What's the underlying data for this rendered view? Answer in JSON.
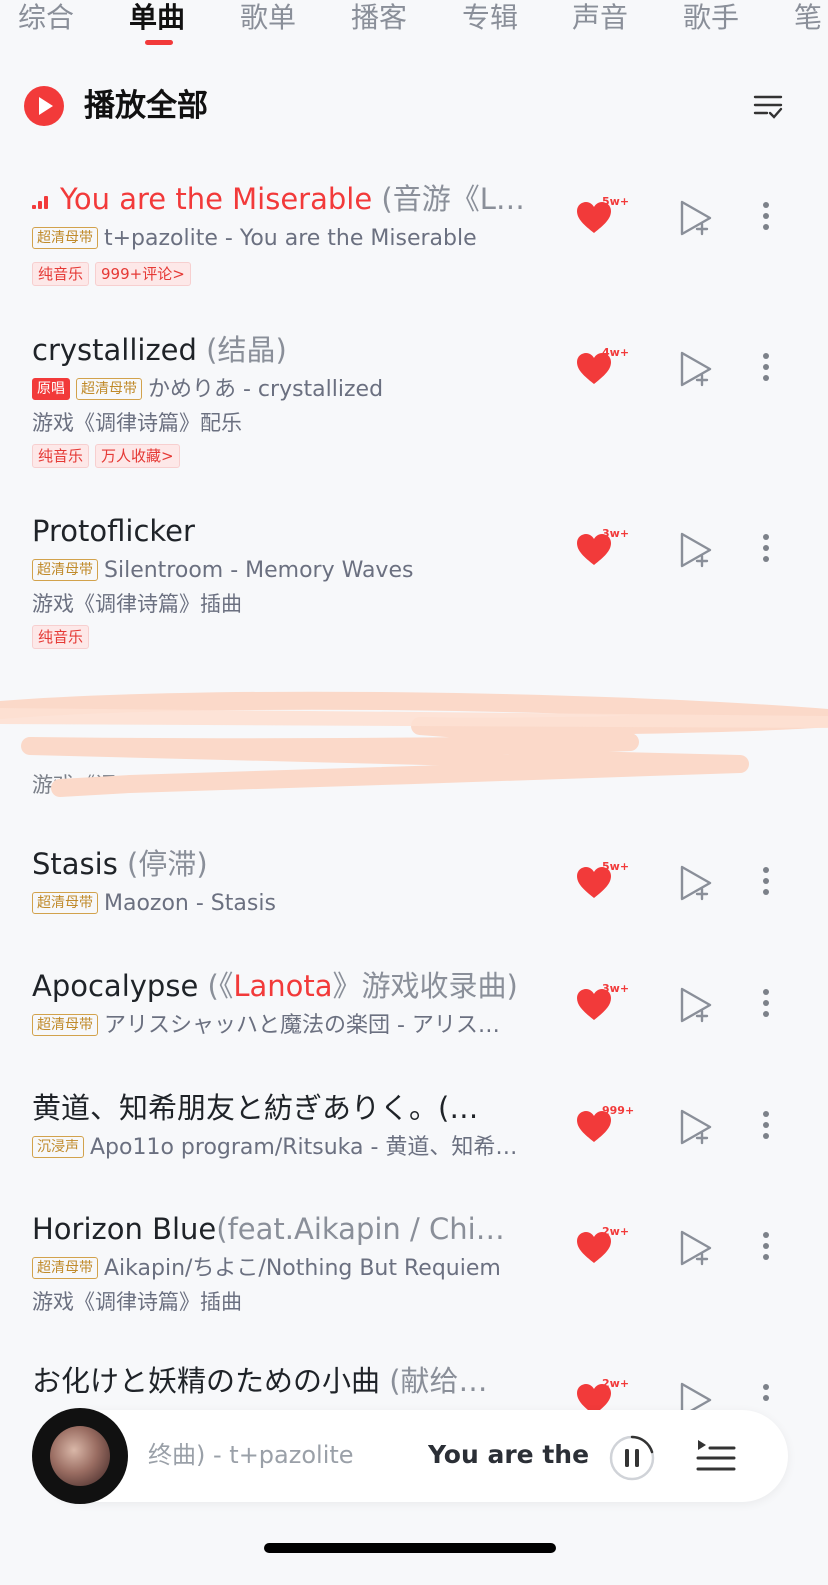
{
  "tabs": [
    "综合",
    "单曲",
    "歌单",
    "播客",
    "专辑",
    "声音",
    "歌手",
    "笔"
  ],
  "active_tab": "单曲",
  "play_all": {
    "label": "播放全部"
  },
  "songs": [
    {
      "title": "You are the Miserable",
      "sub": " (音游《L…",
      "meta_badges": [
        "超清母带"
      ],
      "meta": "t+pazolite - You are the Miserable",
      "tags": [
        "纯音乐",
        "999+评论>"
      ],
      "likes": "5w+"
    },
    {
      "title": "crystallized",
      "sub": " (结晶)",
      "meta_badges": [
        "原唱",
        "超清母带"
      ],
      "meta": "かめりあ - crystallized",
      "line3": "游戏《调律诗篇》配乐",
      "tags": [
        "纯音乐",
        "万人收藏>"
      ],
      "likes": "4w+"
    },
    {
      "title": "Protoflicker",
      "sub": "",
      "meta_badges": [
        "超清母带"
      ],
      "meta": "Silentroom - Memory Waves",
      "line3": "游戏《调律诗篇》插曲",
      "tags": [
        "纯音乐"
      ],
      "likes": "3w+"
    },
    {
      "title": "Stasis",
      "sub": " (停滞)",
      "meta_badges": [
        "超清母带"
      ],
      "meta": "Maozon - Stasis",
      "likes": "5w+"
    },
    {
      "title": "Apocalypse",
      "sub_pre": " (《",
      "sub_red": "Lanota",
      "sub_post": "》游戏收录曲)",
      "meta_badges": [
        "超清母带"
      ],
      "meta": "アリスシャッハと魔法の楽団 - アリス…",
      "likes": "3w+"
    },
    {
      "title": "黄道、知希朋友と紡ぎありく。(…",
      "sub": "",
      "meta_badges": [
        "沉浸声"
      ],
      "meta": "Apo11o program/Ritsuka - 黄道、知希…",
      "likes": "999+"
    },
    {
      "title": "Horizon Blue",
      "sub": "(feat.Aikapin / Chi…",
      "meta_badges": [
        "超清母带"
      ],
      "meta": "Aikapin/ちよこ/Nothing But Requiem",
      "line3": "游戏《调律诗篇》插曲",
      "likes": "2w+"
    },
    {
      "title": "お化けと妖精のための小曲",
      "sub": " (献给…",
      "likes": "2w+"
    }
  ],
  "obscured_row": {
    "line3_fragment": "游戏《调"
  },
  "now_playing": {
    "left_text": "终曲) - t+pazolite",
    "right_text": "You are the Miserable"
  }
}
